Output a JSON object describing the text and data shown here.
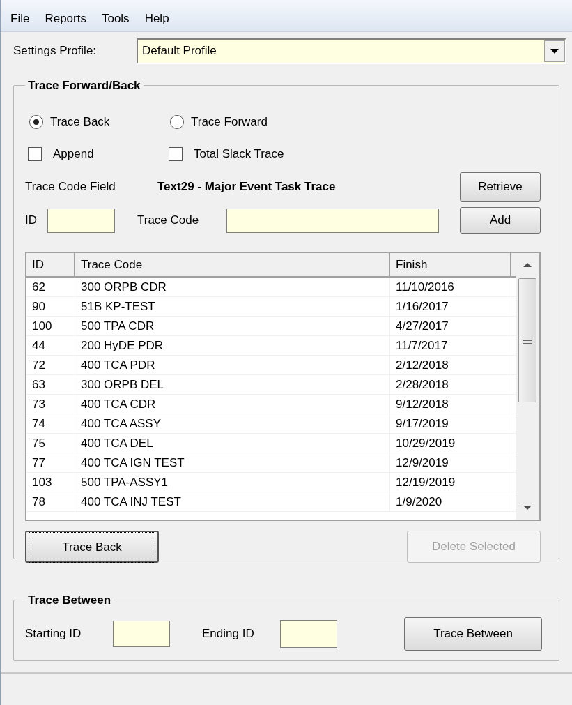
{
  "menu": [
    "File",
    "Reports",
    "Tools",
    "Help"
  ],
  "settings_profile": {
    "label": "Settings Profile:",
    "value": "Default Profile"
  },
  "trace_forward_back": {
    "title": "Trace Forward/Back",
    "direction": [
      {
        "label": "Trace Back",
        "selected": true
      },
      {
        "label": "Trace Forward",
        "selected": false
      }
    ],
    "options": [
      {
        "label": "Append",
        "checked": false
      },
      {
        "label": "Total Slack Trace",
        "checked": false
      }
    ],
    "trace_code_field": {
      "label": "Trace Code Field",
      "value": "Text29 - Major Event Task Trace"
    },
    "retrieve_button": "Retrieve",
    "id_label": "ID",
    "trace_code_label": "Trace Code",
    "add_button": "Add",
    "table": {
      "columns": [
        "ID",
        "Trace Code",
        "Finish"
      ],
      "rows": [
        [
          "62",
          "300 ORPB CDR",
          "11/10/2016"
        ],
        [
          "90",
          "51B KP-TEST",
          "1/16/2017"
        ],
        [
          "100",
          "500 TPA CDR",
          "4/27/2017"
        ],
        [
          "44",
          "200 HyDE PDR",
          "11/7/2017"
        ],
        [
          "72",
          "400 TCA PDR",
          "2/12/2018"
        ],
        [
          "63",
          "300 ORPB DEL",
          "2/28/2018"
        ],
        [
          "73",
          "400 TCA CDR",
          "9/12/2018"
        ],
        [
          "74",
          "400 TCA ASSY",
          "9/17/2019"
        ],
        [
          "75",
          "400 TCA DEL",
          "10/29/2019"
        ],
        [
          "77",
          "400 TCA IGN TEST",
          "12/9/2019"
        ],
        [
          "103",
          "500 TPA-ASSY1",
          "12/19/2019"
        ],
        [
          "78",
          "400 TCA INJ TEST",
          "1/9/2020"
        ]
      ]
    },
    "buttons": [
      {
        "label": "Trace Back",
        "disabled": false
      },
      {
        "label": "Delete Selected",
        "disabled": true
      }
    ]
  },
  "trace_between": {
    "title": "Trace Between",
    "starting_label": "Starting ID",
    "ending_label": "Ending ID",
    "button": "Trace Between"
  }
}
